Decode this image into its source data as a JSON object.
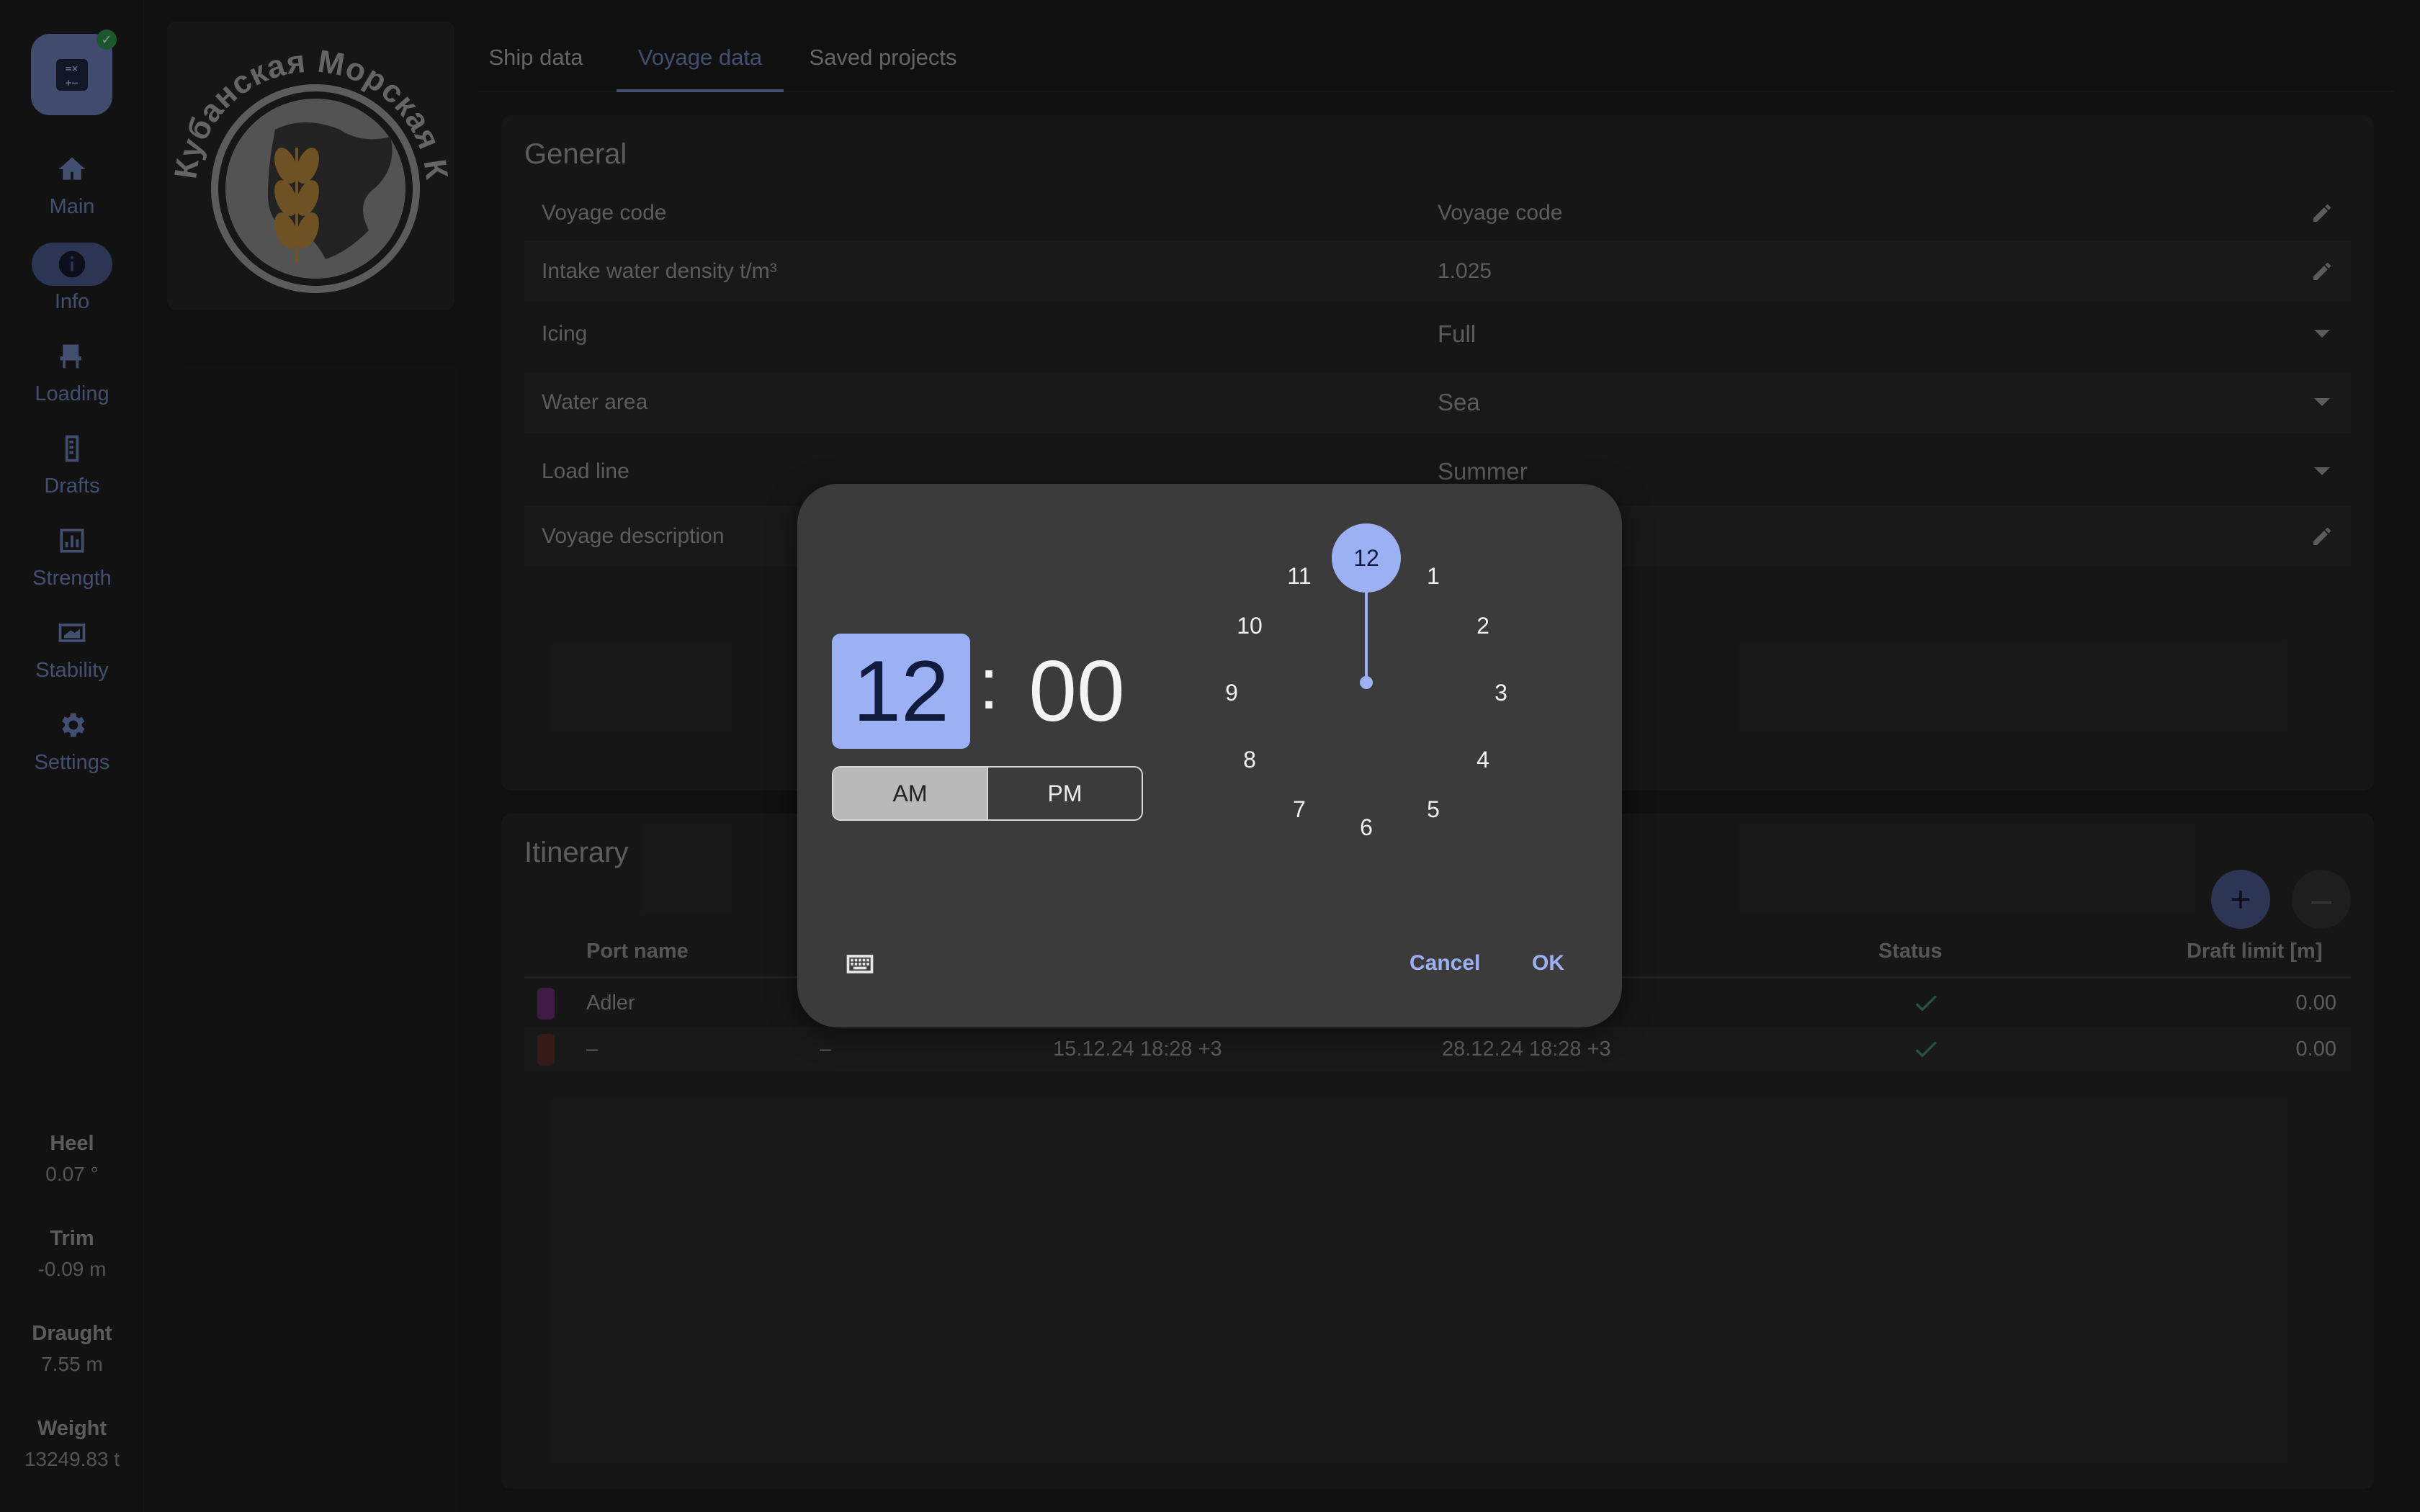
{
  "sidebar": {
    "nav": [
      {
        "label": "Main",
        "icon": "home-icon"
      },
      {
        "label": "Info",
        "icon": "info-icon"
      },
      {
        "label": "Loading",
        "icon": "loading-icon"
      },
      {
        "label": "Drafts",
        "icon": "ruler-icon"
      },
      {
        "label": "Strength",
        "icon": "bar-chart-icon"
      },
      {
        "label": "Stability",
        "icon": "stability-icon"
      },
      {
        "label": "Settings",
        "icon": "gear-icon"
      }
    ],
    "active": "Info",
    "stats": [
      {
        "title": "Heel",
        "value": "0.07 °"
      },
      {
        "title": "Trim",
        "value": "-0.09 m"
      },
      {
        "title": "Draught",
        "value": "7.55 m"
      },
      {
        "title": "Weight",
        "value": "13249.83 t"
      }
    ]
  },
  "logo": {
    "text": "Кубанская Морская Компания"
  },
  "tabs": [
    "Ship data",
    "Voyage data",
    "Saved projects"
  ],
  "active_tab": "Voyage data",
  "general": {
    "title": "General",
    "rows": [
      {
        "label": "Voyage code",
        "value": "Voyage code",
        "control": "edit"
      },
      {
        "label": "Intake water density t/m³",
        "value": "1.025",
        "control": "edit"
      },
      {
        "label": "Icing",
        "value": "Full",
        "control": "dropdown"
      },
      {
        "label": "Water area",
        "value": "Sea",
        "control": "dropdown"
      },
      {
        "label": "Load line",
        "value": "Summer",
        "control": "dropdown"
      },
      {
        "label": "Voyage description",
        "value": "",
        "control": "edit"
      }
    ]
  },
  "itinerary": {
    "title": "Itinerary",
    "headers": {
      "port_name": "Port name",
      "status": "Status",
      "draft_limit": "Draft limit [m]"
    },
    "rows": [
      {
        "color": "#6a2c74",
        "port": "Adler",
        "code": "",
        "eta": "",
        "etd": "",
        "status": "ok",
        "draft_limit": "0.00"
      },
      {
        "color": "#5a2c2c",
        "port": "–",
        "code": "–",
        "eta": "15.12.24 18:28 +3",
        "etd": "28.12.24 18:28 +3",
        "status": "ok",
        "draft_limit": "0.00"
      }
    ],
    "add_label": "+",
    "remove_label": "–"
  },
  "time_picker": {
    "hour": "12",
    "separator": ":",
    "minute": "00",
    "am": "AM",
    "pm": "PM",
    "period": "AM",
    "dial": [
      "12",
      "1",
      "2",
      "3",
      "4",
      "5",
      "6",
      "7",
      "8",
      "9",
      "10",
      "11"
    ],
    "selected": "12",
    "cancel": "Cancel",
    "ok": "OK"
  },
  "colors": {
    "accent": "#9cb1f4",
    "nav": "#6f84bd",
    "check": "#3f8c73"
  }
}
